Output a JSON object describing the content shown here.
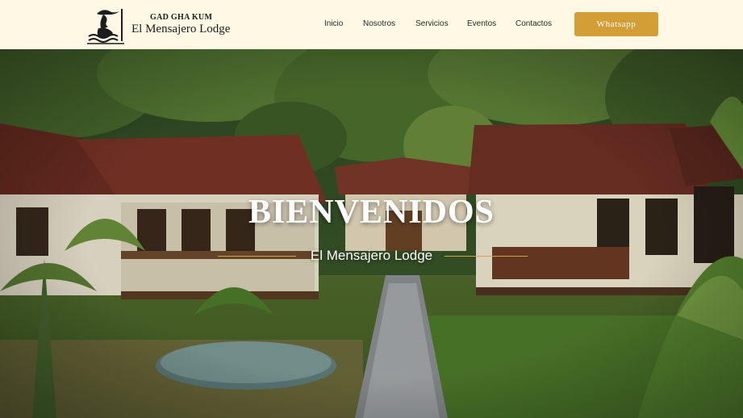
{
  "header": {
    "logo_top": "GAD GHA KUM",
    "logo_bottom": "El Mensajero Lodge",
    "nav": [
      {
        "label": "Inicio"
      },
      {
        "label": "Nosotros"
      },
      {
        "label": "Servicios"
      },
      {
        "label": "Eventos"
      },
      {
        "label": "Contactos"
      }
    ],
    "whatsapp_label": "Whatsapp"
  },
  "hero": {
    "title": "BIENVENIDOS",
    "subtitle": "El Mensajero Lodge"
  },
  "colors": {
    "background": "#fef8e4",
    "accent": "#d49e36",
    "text": "#2a2a2a"
  }
}
